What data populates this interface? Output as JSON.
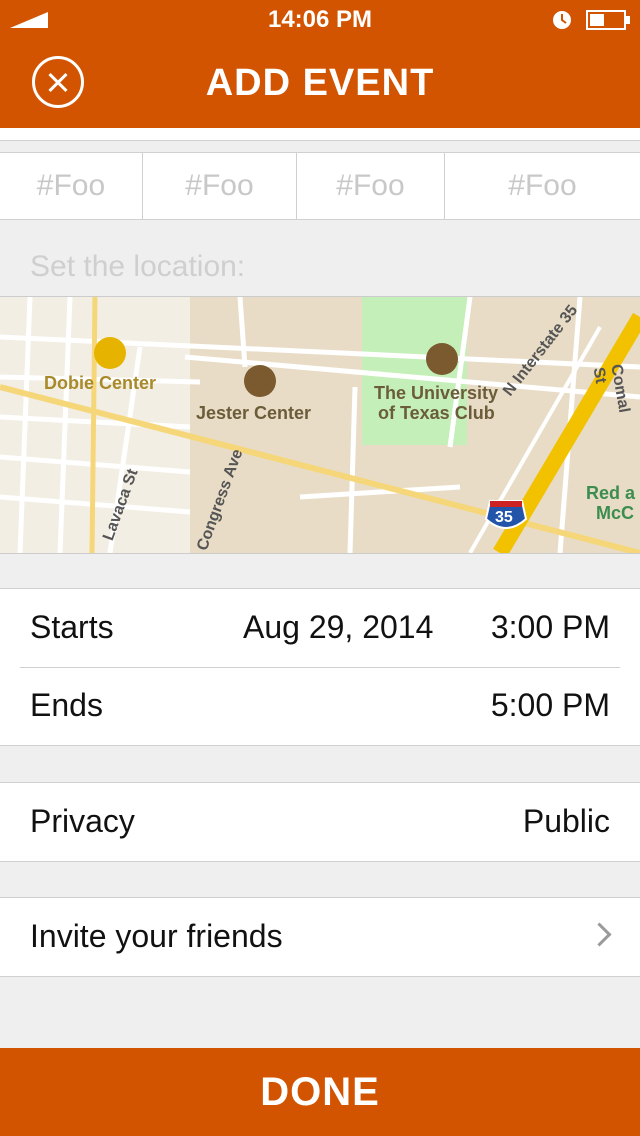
{
  "status_bar": {
    "time": "14:06 PM"
  },
  "header": {
    "title": "ADD EVENT"
  },
  "tags": [
    "#Foo",
    "#Foo",
    "#Foo",
    "#Foo"
  ],
  "location": {
    "placeholder": "Set the location:"
  },
  "map": {
    "labels": {
      "dobie": "Dobie Center",
      "jester": "Jester Center",
      "university_1": "The University",
      "university_2": "of Texas Club",
      "interstate": "N Interstate 35",
      "lavaca": "Lavaca St",
      "congress": "Congress Ave",
      "comal": "Comal St",
      "red_1": "Red a",
      "red_2": "McC",
      "shield": "35"
    }
  },
  "event": {
    "starts_label": "Starts",
    "starts_date": "Aug 29, 2014",
    "starts_time": "3:00 PM",
    "ends_label": "Ends",
    "ends_time": "5:00 PM"
  },
  "privacy": {
    "label": "Privacy",
    "value": "Public"
  },
  "invite": {
    "label": "Invite your friends"
  },
  "footer": {
    "done_label": "DONE"
  },
  "colors": {
    "accent": "#d35400"
  }
}
